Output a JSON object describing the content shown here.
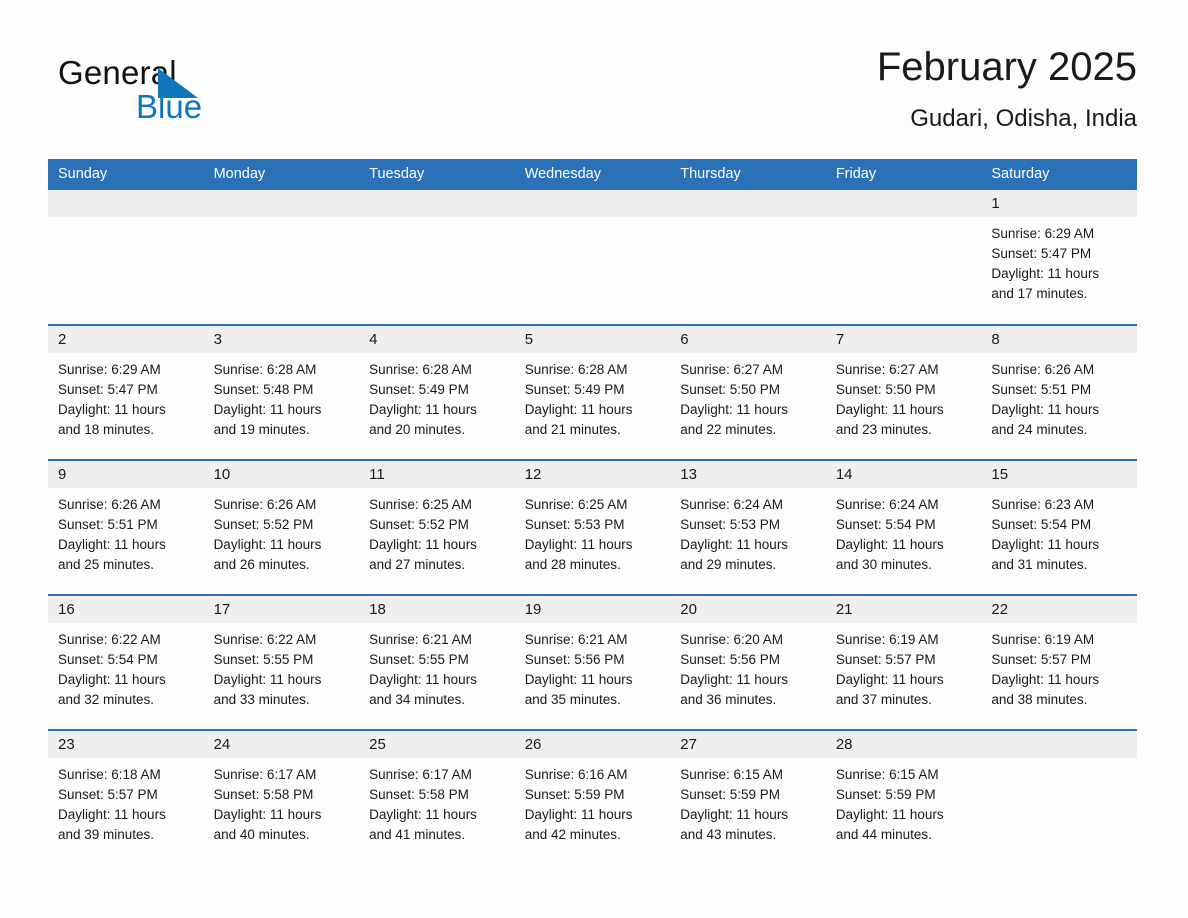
{
  "logo": {
    "word_general": "General",
    "word_blue": "Blue",
    "triangle_color": "#1076bc"
  },
  "header": {
    "title": "February 2025",
    "subtitle": "Gudari, Odisha, India"
  },
  "theme": {
    "header_blue": "#2b71b8",
    "day_band_gray": "#efefef",
    "text": "#1a1a1a",
    "page_bg": "#fdfdfd"
  },
  "weekday_headers": [
    "Sunday",
    "Monday",
    "Tuesday",
    "Wednesday",
    "Thursday",
    "Friday",
    "Saturday"
  ],
  "labels": {
    "sunrise_prefix": "Sunrise:",
    "sunset_prefix": "Sunset:",
    "daylight_prefix": "Daylight:"
  },
  "weeks": [
    [
      {
        "empty": true
      },
      {
        "empty": true
      },
      {
        "empty": true
      },
      {
        "empty": true
      },
      {
        "empty": true
      },
      {
        "empty": true
      },
      {
        "day": "1",
        "sunrise": "Sunrise: 6:29 AM",
        "sunset": "Sunset: 5:47 PM",
        "daylight_l1": "Daylight: 11 hours",
        "daylight_l2": "and 17 minutes."
      }
    ],
    [
      {
        "day": "2",
        "sunrise": "Sunrise: 6:29 AM",
        "sunset": "Sunset: 5:47 PM",
        "daylight_l1": "Daylight: 11 hours",
        "daylight_l2": "and 18 minutes."
      },
      {
        "day": "3",
        "sunrise": "Sunrise: 6:28 AM",
        "sunset": "Sunset: 5:48 PM",
        "daylight_l1": "Daylight: 11 hours",
        "daylight_l2": "and 19 minutes."
      },
      {
        "day": "4",
        "sunrise": "Sunrise: 6:28 AM",
        "sunset": "Sunset: 5:49 PM",
        "daylight_l1": "Daylight: 11 hours",
        "daylight_l2": "and 20 minutes."
      },
      {
        "day": "5",
        "sunrise": "Sunrise: 6:28 AM",
        "sunset": "Sunset: 5:49 PM",
        "daylight_l1": "Daylight: 11 hours",
        "daylight_l2": "and 21 minutes."
      },
      {
        "day": "6",
        "sunrise": "Sunrise: 6:27 AM",
        "sunset": "Sunset: 5:50 PM",
        "daylight_l1": "Daylight: 11 hours",
        "daylight_l2": "and 22 minutes."
      },
      {
        "day": "7",
        "sunrise": "Sunrise: 6:27 AM",
        "sunset": "Sunset: 5:50 PM",
        "daylight_l1": "Daylight: 11 hours",
        "daylight_l2": "and 23 minutes."
      },
      {
        "day": "8",
        "sunrise": "Sunrise: 6:26 AM",
        "sunset": "Sunset: 5:51 PM",
        "daylight_l1": "Daylight: 11 hours",
        "daylight_l2": "and 24 minutes."
      }
    ],
    [
      {
        "day": "9",
        "sunrise": "Sunrise: 6:26 AM",
        "sunset": "Sunset: 5:51 PM",
        "daylight_l1": "Daylight: 11 hours",
        "daylight_l2": "and 25 minutes."
      },
      {
        "day": "10",
        "sunrise": "Sunrise: 6:26 AM",
        "sunset": "Sunset: 5:52 PM",
        "daylight_l1": "Daylight: 11 hours",
        "daylight_l2": "and 26 minutes."
      },
      {
        "day": "11",
        "sunrise": "Sunrise: 6:25 AM",
        "sunset": "Sunset: 5:52 PM",
        "daylight_l1": "Daylight: 11 hours",
        "daylight_l2": "and 27 minutes."
      },
      {
        "day": "12",
        "sunrise": "Sunrise: 6:25 AM",
        "sunset": "Sunset: 5:53 PM",
        "daylight_l1": "Daylight: 11 hours",
        "daylight_l2": "and 28 minutes."
      },
      {
        "day": "13",
        "sunrise": "Sunrise: 6:24 AM",
        "sunset": "Sunset: 5:53 PM",
        "daylight_l1": "Daylight: 11 hours",
        "daylight_l2": "and 29 minutes."
      },
      {
        "day": "14",
        "sunrise": "Sunrise: 6:24 AM",
        "sunset": "Sunset: 5:54 PM",
        "daylight_l1": "Daylight: 11 hours",
        "daylight_l2": "and 30 minutes."
      },
      {
        "day": "15",
        "sunrise": "Sunrise: 6:23 AM",
        "sunset": "Sunset: 5:54 PM",
        "daylight_l1": "Daylight: 11 hours",
        "daylight_l2": "and 31 minutes."
      }
    ],
    [
      {
        "day": "16",
        "sunrise": "Sunrise: 6:22 AM",
        "sunset": "Sunset: 5:54 PM",
        "daylight_l1": "Daylight: 11 hours",
        "daylight_l2": "and 32 minutes."
      },
      {
        "day": "17",
        "sunrise": "Sunrise: 6:22 AM",
        "sunset": "Sunset: 5:55 PM",
        "daylight_l1": "Daylight: 11 hours",
        "daylight_l2": "and 33 minutes."
      },
      {
        "day": "18",
        "sunrise": "Sunrise: 6:21 AM",
        "sunset": "Sunset: 5:55 PM",
        "daylight_l1": "Daylight: 11 hours",
        "daylight_l2": "and 34 minutes."
      },
      {
        "day": "19",
        "sunrise": "Sunrise: 6:21 AM",
        "sunset": "Sunset: 5:56 PM",
        "daylight_l1": "Daylight: 11 hours",
        "daylight_l2": "and 35 minutes."
      },
      {
        "day": "20",
        "sunrise": "Sunrise: 6:20 AM",
        "sunset": "Sunset: 5:56 PM",
        "daylight_l1": "Daylight: 11 hours",
        "daylight_l2": "and 36 minutes."
      },
      {
        "day": "21",
        "sunrise": "Sunrise: 6:19 AM",
        "sunset": "Sunset: 5:57 PM",
        "daylight_l1": "Daylight: 11 hours",
        "daylight_l2": "and 37 minutes."
      },
      {
        "day": "22",
        "sunrise": "Sunrise: 6:19 AM",
        "sunset": "Sunset: 5:57 PM",
        "daylight_l1": "Daylight: 11 hours",
        "daylight_l2": "and 38 minutes."
      }
    ],
    [
      {
        "day": "23",
        "sunrise": "Sunrise: 6:18 AM",
        "sunset": "Sunset: 5:57 PM",
        "daylight_l1": "Daylight: 11 hours",
        "daylight_l2": "and 39 minutes."
      },
      {
        "day": "24",
        "sunrise": "Sunrise: 6:17 AM",
        "sunset": "Sunset: 5:58 PM",
        "daylight_l1": "Daylight: 11 hours",
        "daylight_l2": "and 40 minutes."
      },
      {
        "day": "25",
        "sunrise": "Sunrise: 6:17 AM",
        "sunset": "Sunset: 5:58 PM",
        "daylight_l1": "Daylight: 11 hours",
        "daylight_l2": "and 41 minutes."
      },
      {
        "day": "26",
        "sunrise": "Sunrise: 6:16 AM",
        "sunset": "Sunset: 5:59 PM",
        "daylight_l1": "Daylight: 11 hours",
        "daylight_l2": "and 42 minutes."
      },
      {
        "day": "27",
        "sunrise": "Sunrise: 6:15 AM",
        "sunset": "Sunset: 5:59 PM",
        "daylight_l1": "Daylight: 11 hours",
        "daylight_l2": "and 43 minutes."
      },
      {
        "day": "28",
        "sunrise": "Sunrise: 6:15 AM",
        "sunset": "Sunset: 5:59 PM",
        "daylight_l1": "Daylight: 11 hours",
        "daylight_l2": "and 44 minutes."
      },
      {
        "empty": true
      }
    ]
  ]
}
